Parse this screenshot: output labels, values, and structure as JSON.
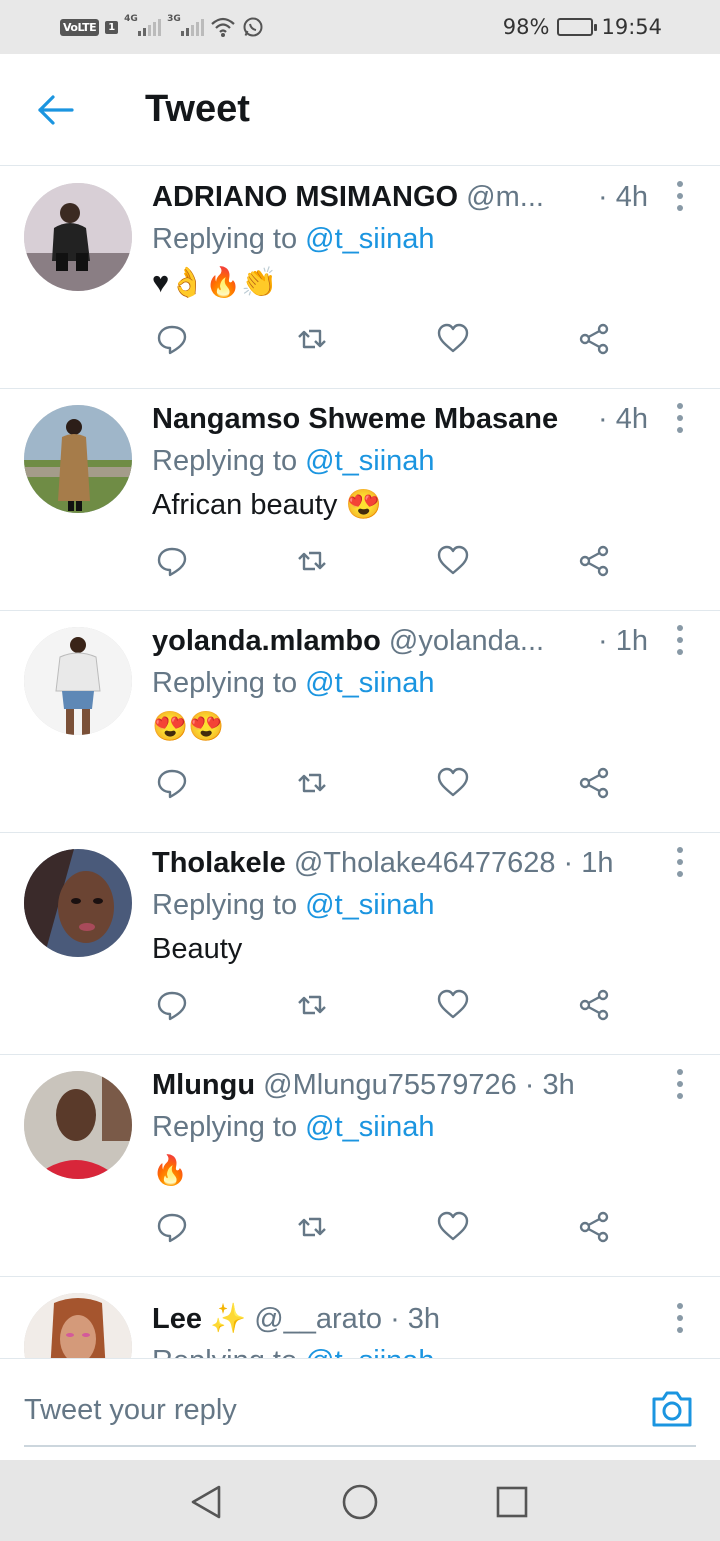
{
  "status_bar": {
    "volte": "VoLTE",
    "sim": "1",
    "net1": "4G",
    "net2": "3G",
    "battery_text": "98%",
    "battery_level": 0.98,
    "time": "19:54"
  },
  "header": {
    "title": "Tweet",
    "back_icon": "arrow-left-icon"
  },
  "reply_prefix": "Replying to ",
  "tweets": [
    {
      "name": "ADRIANO MSIMANGO",
      "handle": "@m...",
      "time": "· 4h",
      "mention": "@t_siinah",
      "text": "♥👌🔥👏"
    },
    {
      "name": "Nangamso Shweme Mbasane",
      "handle": "",
      "time": "· 4h",
      "mention": "@t_siinah",
      "text": "African beauty 😍"
    },
    {
      "name": "yolanda.mlambo",
      "handle": "@yolanda...",
      "time": "· 1h",
      "mention": "@t_siinah",
      "text": "😍😍"
    },
    {
      "name": "Tholakele",
      "handle": "@Tholake46477628",
      "time": "· 1h",
      "mention": "@t_siinah",
      "text": "Beauty"
    },
    {
      "name": "Mlungu",
      "handle": "@Mlungu75579726",
      "time": "· 3h",
      "mention": "@t_siinah",
      "text": "🔥"
    },
    {
      "name": "Lee ✨",
      "handle": "@__arato",
      "time": "· 3h",
      "mention": "@t_siinah",
      "text": ""
    }
  ],
  "reply_bar": {
    "placeholder": "Tweet your reply"
  },
  "colors": {
    "accent": "#1b95e0",
    "text_secondary": "#657786",
    "divider": "#e1e8ed"
  }
}
